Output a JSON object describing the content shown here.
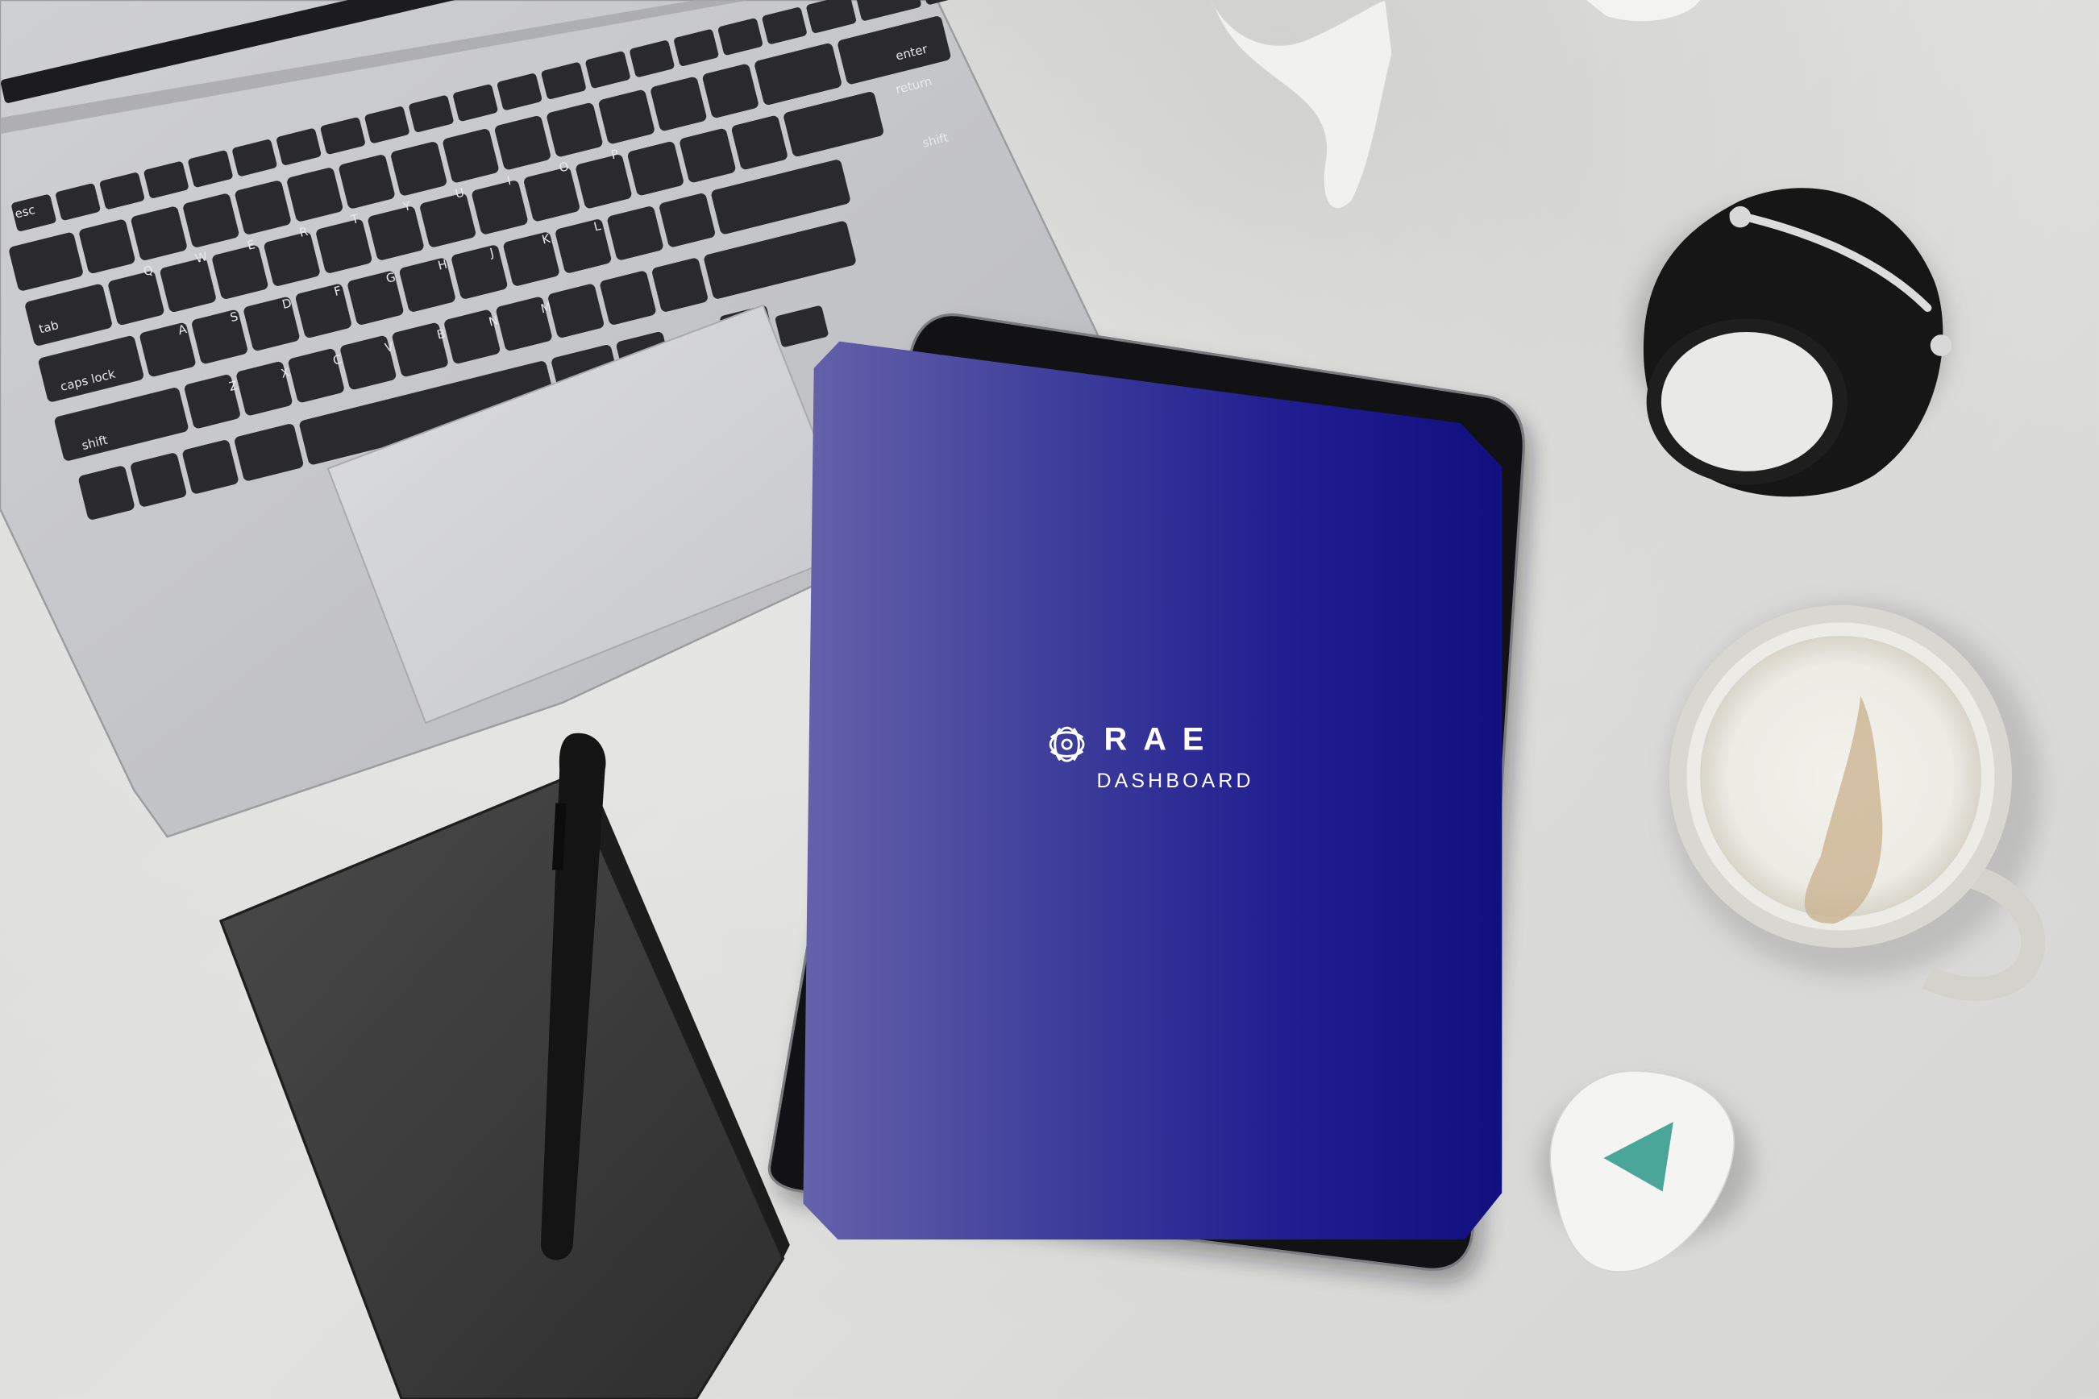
{
  "app": {
    "brand_name": "RAE",
    "brand_subtitle": "DASHBOARD",
    "logo_icon": "rae-knot-logo-icon"
  },
  "colors": {
    "screen_gradient_start": "#6462aa",
    "screen_gradient_end": "#12107f",
    "brand_text": "#ffffff"
  },
  "keyboard": {
    "labels": {
      "esc": "esc",
      "tab": "tab",
      "caps_lock": "caps lock",
      "shift_left": "shift",
      "shift_right": "shift",
      "return": "return",
      "enter": "enter",
      "q": "Q",
      "w": "W",
      "e": "E",
      "r": "R",
      "t": "T",
      "y": "Y",
      "a": "A",
      "s": "S",
      "d": "D",
      "f": "F",
      "g": "G",
      "h": "H",
      "j": "J",
      "k": "K",
      "l": "L",
      "z": "Z",
      "x": "X",
      "c": "C",
      "v": "V",
      "b": "B",
      "n": "N",
      "m": "M",
      "o": "O",
      "p": "P",
      "i": "I",
      "u": "U"
    }
  }
}
